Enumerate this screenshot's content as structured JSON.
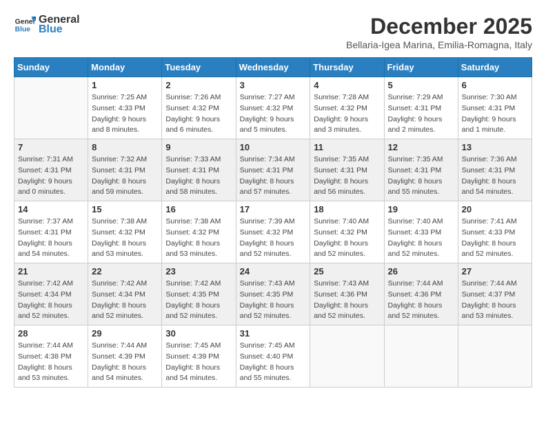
{
  "logo": {
    "general": "General",
    "blue": "Blue"
  },
  "title": "December 2025",
  "location": "Bellaria-Igea Marina, Emilia-Romagna, Italy",
  "days_of_week": [
    "Sunday",
    "Monday",
    "Tuesday",
    "Wednesday",
    "Thursday",
    "Friday",
    "Saturday"
  ],
  "weeks": [
    [
      {
        "day": "",
        "info": ""
      },
      {
        "day": "1",
        "info": "Sunrise: 7:25 AM\nSunset: 4:33 PM\nDaylight: 9 hours and 8 minutes."
      },
      {
        "day": "2",
        "info": "Sunrise: 7:26 AM\nSunset: 4:32 PM\nDaylight: 9 hours and 6 minutes."
      },
      {
        "day": "3",
        "info": "Sunrise: 7:27 AM\nSunset: 4:32 PM\nDaylight: 9 hours and 5 minutes."
      },
      {
        "day": "4",
        "info": "Sunrise: 7:28 AM\nSunset: 4:32 PM\nDaylight: 9 hours and 3 minutes."
      },
      {
        "day": "5",
        "info": "Sunrise: 7:29 AM\nSunset: 4:31 PM\nDaylight: 9 hours and 2 minutes."
      },
      {
        "day": "6",
        "info": "Sunrise: 7:30 AM\nSunset: 4:31 PM\nDaylight: 9 hours and 1 minute."
      }
    ],
    [
      {
        "day": "7",
        "info": "Sunrise: 7:31 AM\nSunset: 4:31 PM\nDaylight: 9 hours and 0 minutes."
      },
      {
        "day": "8",
        "info": "Sunrise: 7:32 AM\nSunset: 4:31 PM\nDaylight: 8 hours and 59 minutes."
      },
      {
        "day": "9",
        "info": "Sunrise: 7:33 AM\nSunset: 4:31 PM\nDaylight: 8 hours and 58 minutes."
      },
      {
        "day": "10",
        "info": "Sunrise: 7:34 AM\nSunset: 4:31 PM\nDaylight: 8 hours and 57 minutes."
      },
      {
        "day": "11",
        "info": "Sunrise: 7:35 AM\nSunset: 4:31 PM\nDaylight: 8 hours and 56 minutes."
      },
      {
        "day": "12",
        "info": "Sunrise: 7:35 AM\nSunset: 4:31 PM\nDaylight: 8 hours and 55 minutes."
      },
      {
        "day": "13",
        "info": "Sunrise: 7:36 AM\nSunset: 4:31 PM\nDaylight: 8 hours and 54 minutes."
      }
    ],
    [
      {
        "day": "14",
        "info": "Sunrise: 7:37 AM\nSunset: 4:31 PM\nDaylight: 8 hours and 54 minutes."
      },
      {
        "day": "15",
        "info": "Sunrise: 7:38 AM\nSunset: 4:32 PM\nDaylight: 8 hours and 53 minutes."
      },
      {
        "day": "16",
        "info": "Sunrise: 7:38 AM\nSunset: 4:32 PM\nDaylight: 8 hours and 53 minutes."
      },
      {
        "day": "17",
        "info": "Sunrise: 7:39 AM\nSunset: 4:32 PM\nDaylight: 8 hours and 52 minutes."
      },
      {
        "day": "18",
        "info": "Sunrise: 7:40 AM\nSunset: 4:32 PM\nDaylight: 8 hours and 52 minutes."
      },
      {
        "day": "19",
        "info": "Sunrise: 7:40 AM\nSunset: 4:33 PM\nDaylight: 8 hours and 52 minutes."
      },
      {
        "day": "20",
        "info": "Sunrise: 7:41 AM\nSunset: 4:33 PM\nDaylight: 8 hours and 52 minutes."
      }
    ],
    [
      {
        "day": "21",
        "info": "Sunrise: 7:42 AM\nSunset: 4:34 PM\nDaylight: 8 hours and 52 minutes."
      },
      {
        "day": "22",
        "info": "Sunrise: 7:42 AM\nSunset: 4:34 PM\nDaylight: 8 hours and 52 minutes."
      },
      {
        "day": "23",
        "info": "Sunrise: 7:42 AM\nSunset: 4:35 PM\nDaylight: 8 hours and 52 minutes."
      },
      {
        "day": "24",
        "info": "Sunrise: 7:43 AM\nSunset: 4:35 PM\nDaylight: 8 hours and 52 minutes."
      },
      {
        "day": "25",
        "info": "Sunrise: 7:43 AM\nSunset: 4:36 PM\nDaylight: 8 hours and 52 minutes."
      },
      {
        "day": "26",
        "info": "Sunrise: 7:44 AM\nSunset: 4:36 PM\nDaylight: 8 hours and 52 minutes."
      },
      {
        "day": "27",
        "info": "Sunrise: 7:44 AM\nSunset: 4:37 PM\nDaylight: 8 hours and 53 minutes."
      }
    ],
    [
      {
        "day": "28",
        "info": "Sunrise: 7:44 AM\nSunset: 4:38 PM\nDaylight: 8 hours and 53 minutes."
      },
      {
        "day": "29",
        "info": "Sunrise: 7:44 AM\nSunset: 4:39 PM\nDaylight: 8 hours and 54 minutes."
      },
      {
        "day": "30",
        "info": "Sunrise: 7:45 AM\nSunset: 4:39 PM\nDaylight: 8 hours and 54 minutes."
      },
      {
        "day": "31",
        "info": "Sunrise: 7:45 AM\nSunset: 4:40 PM\nDaylight: 8 hours and 55 minutes."
      },
      {
        "day": "",
        "info": ""
      },
      {
        "day": "",
        "info": ""
      },
      {
        "day": "",
        "info": ""
      }
    ]
  ]
}
